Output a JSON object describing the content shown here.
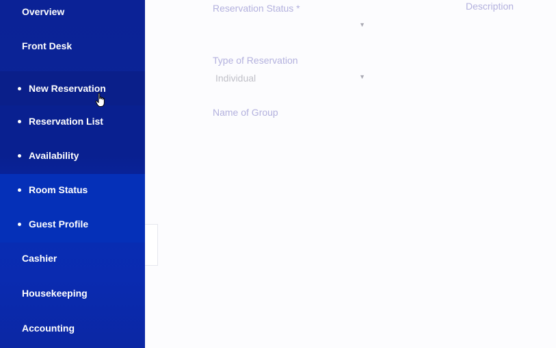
{
  "sidebar": {
    "items": [
      {
        "label": "Overview"
      },
      {
        "label": "Front Desk"
      },
      {
        "label": "Cashier"
      },
      {
        "label": "Housekeeping"
      },
      {
        "label": "Accounting"
      }
    ],
    "front_desk_sub": [
      {
        "label": "New Reservation"
      },
      {
        "label": "Reservation List"
      },
      {
        "label": "Availability"
      },
      {
        "label": "Room Status"
      },
      {
        "label": "Guest Profile"
      }
    ]
  },
  "form": {
    "status_label": "Reservation Status *",
    "status_value": "",
    "type_label": "Type of Reservation",
    "type_value": "Individual",
    "group_label": "Name of Group",
    "description_label": "Description"
  },
  "icons": {
    "cursor": "hand-pointer-icon",
    "dropdown": "triangle-down-icon"
  },
  "colors": {
    "sidebar": "#0b2596",
    "label": "#b3b1de"
  }
}
